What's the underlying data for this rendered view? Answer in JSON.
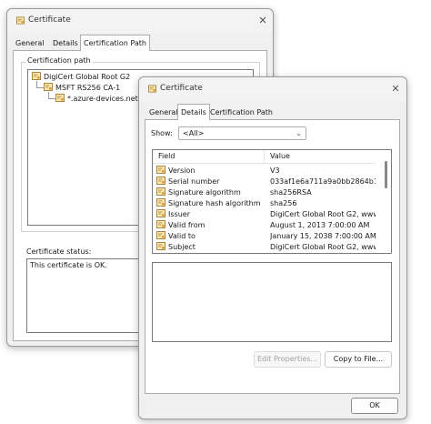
{
  "back_dialog": {
    "title": "Certificate",
    "tabs": [
      "General",
      "Details",
      "Certification Path"
    ],
    "active_tab": "Certification Path",
    "cert_path_label": "Certification path",
    "tree": [
      "DigiCert Global Root G2",
      "MSFT RS256 CA-1",
      "*.azure-devices.net"
    ],
    "status_label": "Certificate status:",
    "status_text": "This certificate is OK."
  },
  "front_dialog": {
    "title": "Certificate",
    "tabs": [
      "General",
      "Details",
      "Certification Path"
    ],
    "active_tab": "Details",
    "show_label": "Show:",
    "show_value": "<All>",
    "columns": [
      "Field",
      "Value"
    ],
    "rows": [
      {
        "field": "Version",
        "value": "V3"
      },
      {
        "field": "Serial number",
        "value": "033af1e6a711a9a0bb2864b1..."
      },
      {
        "field": "Signature algorithm",
        "value": "sha256RSA"
      },
      {
        "field": "Signature hash algorithm",
        "value": "sha256"
      },
      {
        "field": "Issuer",
        "value": "DigiCert Global Root G2, www...."
      },
      {
        "field": "Valid from",
        "value": "August 1, 2013 7:00:00 AM"
      },
      {
        "field": "Valid to",
        "value": "January 15, 2038 7:00:00 AM"
      },
      {
        "field": "Subject",
        "value": "DigiCert Global Root G2, www...."
      }
    ],
    "edit_properties_label": "Edit Properties...",
    "copy_to_file_label": "Copy to File...",
    "ok_label": "OK"
  },
  "colors": {
    "cert_icon": "#d8a43a",
    "cert_icon_dark": "#9a6a14",
    "disabled_text": "#a0a0a0"
  },
  "icons": {
    "certificate": "certificate-icon",
    "close": "close-icon",
    "dropdown": "chevron-down-icon"
  }
}
